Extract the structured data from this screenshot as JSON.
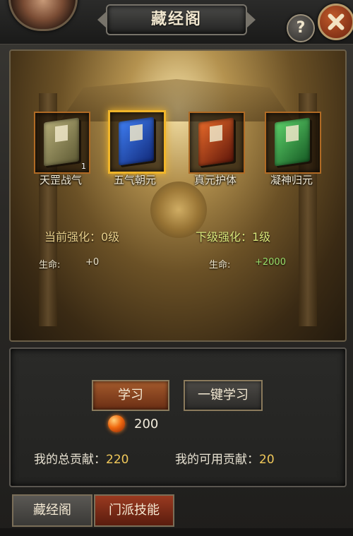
{
  "header": {
    "title": "藏经阁",
    "help_label": "?"
  },
  "books": [
    {
      "name": "天罡战气",
      "count": "1",
      "color": "#8a8458",
      "selected": false
    },
    {
      "name": "五气朝元",
      "count": "",
      "color": "#2a5ad0",
      "selected": true
    },
    {
      "name": "真元护体",
      "count": "",
      "color": "#c0441a",
      "selected": false
    },
    {
      "name": "凝神归元",
      "count": "",
      "color": "#3aa04a",
      "selected": false
    }
  ],
  "stats": {
    "current_label": "当前强化：0级",
    "next_label": "下级强化：1级",
    "current_hp_label": "生命:",
    "current_hp_value": "+0",
    "next_hp_label": "生命:",
    "next_hp_value": "+2000"
  },
  "actions": {
    "learn_label": "学习",
    "onekey_label": "一键学习",
    "cost": "200"
  },
  "contribution": {
    "total_label": "我的总贡献：",
    "total_value": "220",
    "usable_label": "我的可用贡献：",
    "usable_value": "20"
  },
  "tabs": [
    {
      "label": "藏经阁"
    },
    {
      "label": "门派技能"
    }
  ],
  "colors": {
    "accent_gold": "#f0b52a",
    "stat_current": "#e8cf8a",
    "stat_next": "#d9e67a",
    "hp_next": "#9be06a"
  }
}
